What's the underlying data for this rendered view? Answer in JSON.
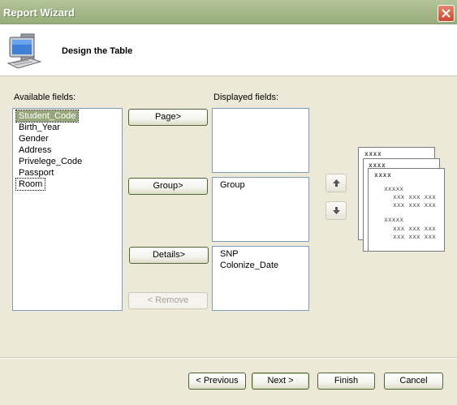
{
  "window": {
    "title": "Report Wizard",
    "close_icon": "close-icon"
  },
  "header": {
    "title": "Design the Table",
    "icon": "computer-icon"
  },
  "available": {
    "label": "Available fields:",
    "items": [
      "Student_Code",
      "Birth_Year",
      "Gender",
      "Address",
      "Privelege_Code",
      "Passport",
      "Room"
    ],
    "selected_index": 0
  },
  "displayed": {
    "label": "Displayed fields:",
    "page_items": [],
    "group_items": [
      "Group"
    ],
    "detail_items": [
      "SNP",
      "Colonize_Date"
    ]
  },
  "buttons": {
    "page": "Page>",
    "group": "Group>",
    "details": "Details>",
    "remove": "< Remove",
    "previous": "< Previous",
    "next": "Next >",
    "finish": "Finish",
    "cancel": "Cancel"
  },
  "preview": {
    "header_text": "xxxx",
    "group_text": "xxxxx",
    "detail_text": "xxx xxx xxx"
  },
  "colors": {
    "title_bar": "#a6b98a",
    "selection": "#98a77b",
    "close_button": "#c94a2f"
  }
}
